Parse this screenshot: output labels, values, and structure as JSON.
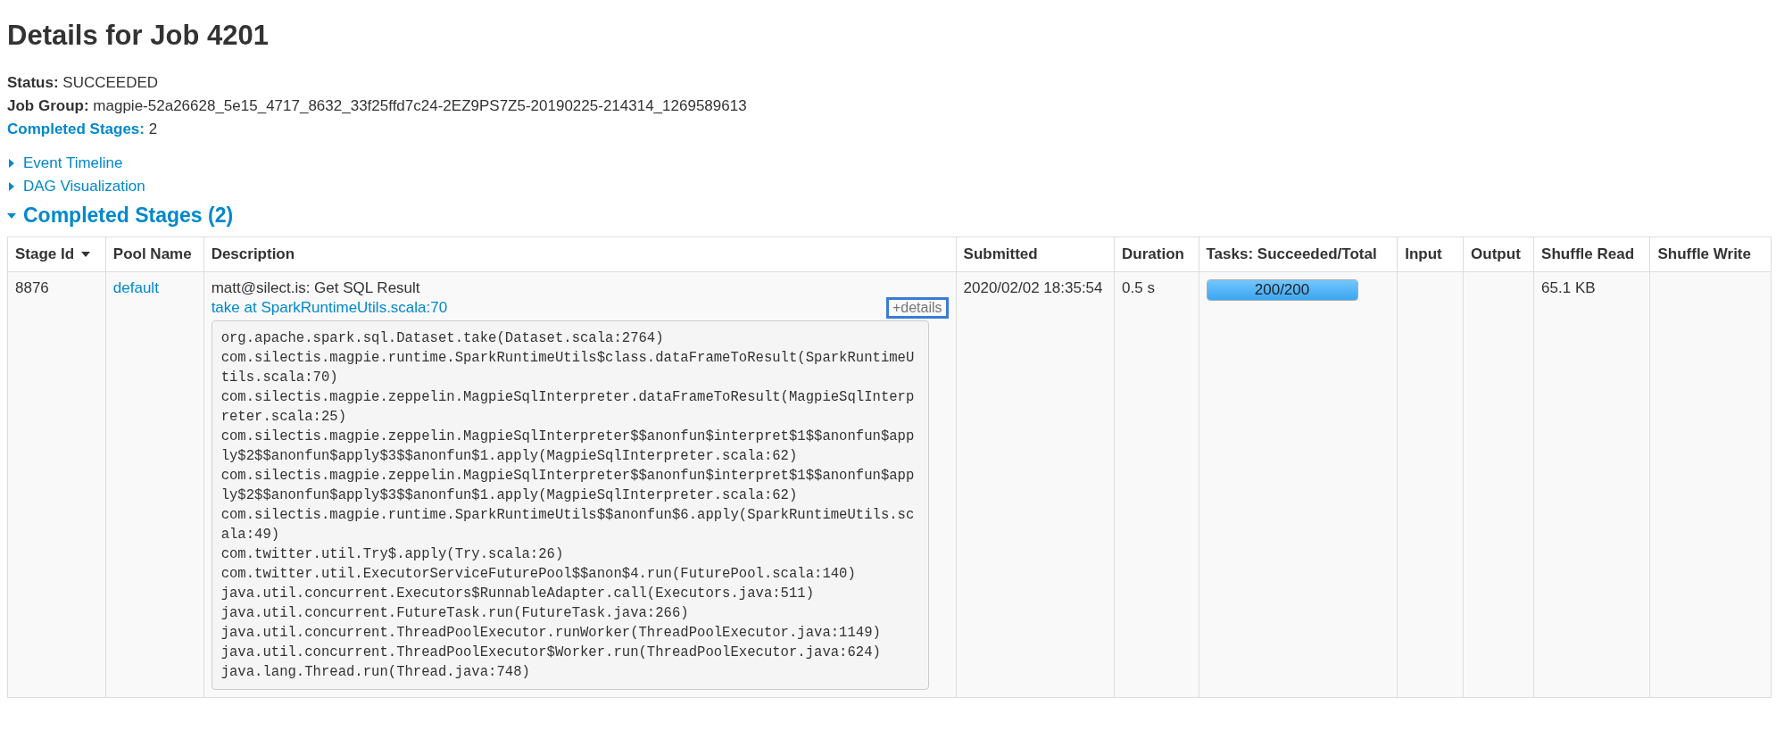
{
  "title": "Details for Job 4201",
  "summary": [
    {
      "label": "Status:",
      "value": "SUCCEEDED",
      "link": false
    },
    {
      "label": "Job Group:",
      "value": "magpie-52a26628_5e15_4717_8632_33f25ffd7c24-2EZ9PS7Z5-20190225-214314_1269589613",
      "link": false
    },
    {
      "label": "Completed Stages:",
      "value": "2",
      "link": true
    }
  ],
  "toggles": [
    {
      "label": "Event Timeline",
      "expanded": false
    },
    {
      "label": "DAG Visualization",
      "expanded": false
    }
  ],
  "section": {
    "label": "Completed Stages (2)",
    "expanded": true
  },
  "table": {
    "columns": [
      {
        "label": "Stage Id",
        "sorted": true
      },
      {
        "label": "Pool Name",
        "sorted": false
      },
      {
        "label": "Description",
        "sorted": false
      },
      {
        "label": "Submitted",
        "sorted": false
      },
      {
        "label": "Duration",
        "sorted": false
      },
      {
        "label": "Tasks: Succeeded/Total",
        "sorted": false
      },
      {
        "label": "Input",
        "sorted": false
      },
      {
        "label": "Output",
        "sorted": false
      },
      {
        "label": "Shuffle Read",
        "sorted": false
      },
      {
        "label": "Shuffle Write",
        "sorted": false
      }
    ],
    "rows": [
      {
        "stage_id": "8876",
        "pool": "default",
        "description": "matt@silect.is: Get SQL Result",
        "call_site": "take at SparkRuntimeUtils.scala:70",
        "details_button": "+details",
        "details_expanded": true,
        "stack": [
          "org.apache.spark.sql.Dataset.take(Dataset.scala:2764)",
          "com.silectis.magpie.runtime.SparkRuntimeUtils$class.dataFrameToResult(SparkRuntimeUtils.scala:70)",
          "com.silectis.magpie.zeppelin.MagpieSqlInterpreter.dataFrameToResult(MagpieSqlInterpreter.scala:25)",
          "com.silectis.magpie.zeppelin.MagpieSqlInterpreter$$anonfun$interpret$1$$anonfun$apply$2$$anonfun$apply$3$$anonfun$1.apply(MagpieSqlInterpreter.scala:62)",
          "com.silectis.magpie.zeppelin.MagpieSqlInterpreter$$anonfun$interpret$1$$anonfun$apply$2$$anonfun$apply$3$$anonfun$1.apply(MagpieSqlInterpreter.scala:62)",
          "com.silectis.magpie.runtime.SparkRuntimeUtils$$anonfun$6.apply(SparkRuntimeUtils.scala:49)",
          "com.twitter.util.Try$.apply(Try.scala:26)",
          "com.twitter.util.ExecutorServiceFuturePool$$anon$4.run(FuturePool.scala:140)",
          "java.util.concurrent.Executors$RunnableAdapter.call(Executors.java:511)",
          "java.util.concurrent.FutureTask.run(FutureTask.java:266)",
          "java.util.concurrent.ThreadPoolExecutor.runWorker(ThreadPoolExecutor.java:1149)",
          "java.util.concurrent.ThreadPoolExecutor$Worker.run(ThreadPoolExecutor.java:624)",
          "java.lang.Thread.run(Thread.java:748)"
        ],
        "submitted": "2020/02/02 18:35:54",
        "duration": "0.5 s",
        "tasks": "200/200",
        "level": 1,
        "shuffle_read": "65.1 KB"
      }
    ]
  }
}
